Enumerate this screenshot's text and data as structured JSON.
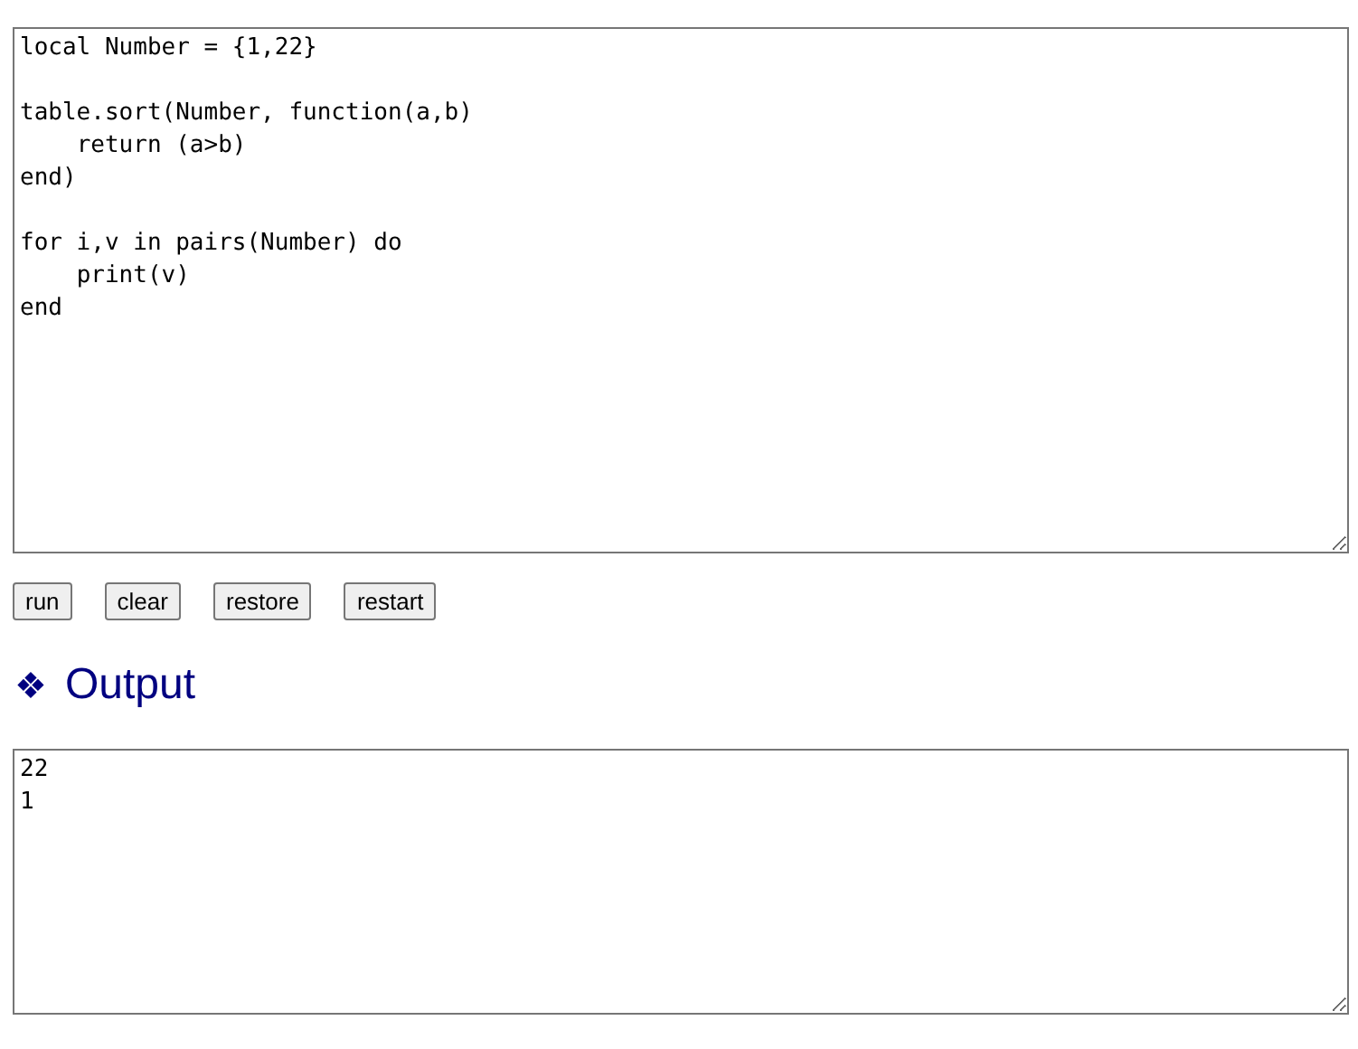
{
  "editor": {
    "code": "local Number = {1,22}\n\ntable.sort(Number, function(a,b)\n    return (a>b)\nend)\n\nfor i,v in pairs(Number) do\n    print(v)\nend"
  },
  "buttons": [
    "run",
    "clear",
    "restore",
    "restart"
  ],
  "output_heading": {
    "icon": "❖",
    "title": "Output"
  },
  "output": {
    "text": "22\n1"
  }
}
